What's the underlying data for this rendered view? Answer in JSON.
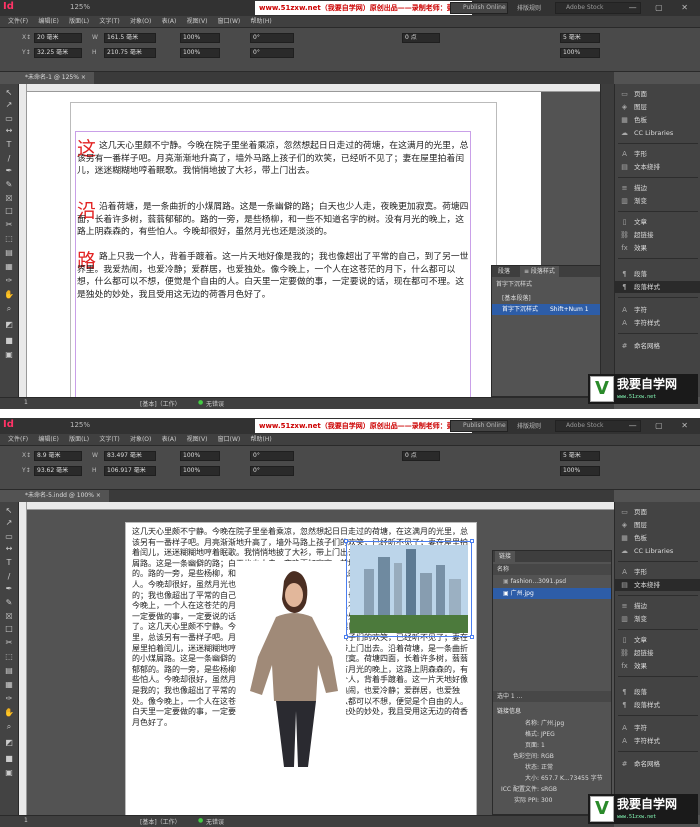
{
  "app": {
    "logo": "Id",
    "zoom": "125%",
    "banner": "www.51zxw.net（我要自学网）原创出品——录制老师：彭致鹏",
    "publish_online": "Publish Online",
    "workspace": "排版规则",
    "stock_search": "Adobe Stock",
    "window_controls": "— ▢ ✕"
  },
  "menu": [
    "文件(F)",
    "编辑(E)",
    "版面(L)",
    "文字(T)",
    "对象(O)",
    "表(A)",
    "视图(V)",
    "窗口(W)",
    "帮助(H)"
  ],
  "shot1": {
    "control": {
      "x": "20 毫米",
      "y": "32.25 毫米",
      "w": "161.5 毫米",
      "h": "210.75 毫米",
      "scale_x": "100%",
      "scale_y": "100%",
      "angle": "0°",
      "shear": "0°",
      "stroke": "0 点",
      "cols": "5 毫米",
      "pct": "100%"
    },
    "doc_tab": "*未命名-1 @ 125%",
    "doc_tab_close": "×",
    "paragraphs": [
      "这几天心里颇不宁静。今晚在院子里坐着乘凉，忽然想起日日走过的荷塘，在这满月的光里，总该另有一番样子吧。月亮渐渐地升高了，墙外马路上孩子们的欢笑，已经听不见了；妻在屋里拍着闰儿，迷迷糊糊地哼着眠歌。我悄悄地披了大衫，带上门出去。",
      "沿着荷塘，是一条曲折的小煤屑路。这是一条幽僻的路；白天也少人走，夜晚更加寂寞。荷塘四面，长着许多树，蓊蓊郁郁的。路的一旁，是些杨柳，和一些不知道名字的树。没有月光的晚上，这路上阴森森的，有些怕人。今晚却很好，虽然月光也还是淡淡的。",
      "路上只我一个人，背着手踱着。这一片天地好像是我的；我也像超出了平常的自己，到了另一世界里。我爱热闹，也爱冷静；爱群居，也爱独处。像今晚上，一个人在这苍茫的月下，什么都可以想，什么都可以不想，便觉是个自由的人。白天里一定要做的事，一定要说的话，现在都可不理。这是独处的妙处，我且受用这无边的荷香月色好了。"
    ],
    "drops": [
      "这",
      "沿",
      "路"
    ],
    "para_panel": {
      "tabs": [
        "段落",
        "≡ 段落样式"
      ],
      "current": "首字下沉样式",
      "rows": [
        "[基本段落]",
        "首字下沉样式",
        "Shift+Num 1"
      ]
    },
    "status": {
      "page": "1",
      "style": "[基本]（工作）",
      "errors": "无错误"
    }
  },
  "shot2": {
    "control": {
      "x": "8.9 毫米",
      "y": "93.62 毫米",
      "w": "83.497 毫米",
      "h": "106.917 毫米",
      "scale_x": "100%",
      "scale_y": "100%",
      "angle": "0°",
      "shear": "0°",
      "stroke": "0 点",
      "cols": "5 毫米",
      "pct": "100%"
    },
    "doc_tab": "*未命名-5.indd @ 100%",
    "doc_tab_close": "×",
    "body": "这几天心里颇不宁静。今晚在院子里坐着乘凉，忽然想起日日走过的荷塘，在这满月的光里，总该另有一番样子吧。月亮渐渐地升高了，墙外马路上孩子们的欢笑，已经听不见了；妻在屋里拍着闰儿，迷迷糊糊地哼着眠歌。我悄悄地披了大衫，带上门出去。沿着荷塘，是一条曲折的小煤屑路。这是一条幽僻的路；白天也少人走，夜晚更加寂寞。荷塘四面，长着许多树，蓊蓊郁郁的。路的一旁，是些杨柳，和一些不知道名字的树。没有月光的晚上，这路上阴森森的，有些怕人。今晚却很好，虽然月光也还是淡淡的。路上只我一个人，背着手踱着。这一片天地好像是我的；我也像超出了平常的自己，到了另一世界里。我爱热闹，也爱冷静；爱群居，也爱独处。像今晚上，一个人在这苍茫的月下，什么都可以想，什么都可以不想，便觉是个自由的人。白天里一定要做的事，一定要说的话，现在都可不理。这是独处的妙处，我且受用这无边的荷香月色好了。这几天心里颇不宁静。今晚在院子里坐着乘凉，忽然想起日日走过的荷塘，在这满月的光里，总该另有一番样子吧。月亮渐渐地升高了，墙外马路上孩子们的欢笑，已经听不见了；妻在屋里拍着闰儿，迷迷糊糊地哼着眠歌。我悄悄地披了大衫，带上门出去。沿着荷塘，是一条曲折的小煤屑路。这是一条幽僻的路；白天也少人走，夜晚更加寂寞。荷塘四面，长着许多树，蓊蓊郁郁的。路的一旁，是些杨柳，和一些不知道名字的树。没有月光的晚上，这路上阴森森的，有些怕人。今晚却很好，虽然月光也还是淡淡的。路上只我一个人，背着手踱着。这一片天地好像是我的；我也像超出了平常的自己，到了另一世界里。我爱热闹，也爱冷静；爱群居，也爱独处。像今晚上，一个人在这苍茫的月下，什么都可以想，什么都可以不想，便觉是个自由的人。白天里一定要做的事，一定要说的话，现在都可不理。这是独处的妙处，我且受用这无边的荷香月色好了。",
    "links_panel": {
      "title": "链接",
      "col_name": "名称",
      "files": [
        "fashion...3091.psd",
        "广州.jpg"
      ],
      "count_label": "选中 1 ...",
      "info_title": "链接信息",
      "info": [
        [
          "名称",
          "广州.jpg"
        ],
        [
          "格式",
          "JPEG"
        ],
        [
          "页面",
          "1"
        ],
        [
          "色彩空间",
          "RGB"
        ],
        [
          "状态",
          "正常"
        ],
        [
          "大小",
          "657.7 K...73455 字节"
        ],
        [
          "ICC 配置文件",
          "sRGB"
        ],
        [
          "实际 PPI",
          "300"
        ]
      ]
    },
    "status": {
      "page": "1",
      "style": "[基本]（工作）",
      "errors": "无错误"
    }
  },
  "dock": {
    "g1": [
      "页面",
      "图层",
      "色板",
      "CC Libraries"
    ],
    "g2": [
      "字形",
      "文本绕排"
    ],
    "g3": [
      "描边",
      "渐变"
    ],
    "g4": [
      "文章",
      "超链接",
      "效果"
    ],
    "g5": [
      "段落",
      "段落样式"
    ],
    "g6": [
      "字符",
      "字符样式"
    ],
    "g7": [
      "命名网格"
    ]
  },
  "watermark": {
    "v": "V",
    "text": "我要自学网",
    "url": "www.51zxw.net"
  },
  "colors": {
    "drop_cap": "#e22222",
    "accent": "#4a7ef0",
    "banner_text": "#cc0000"
  }
}
